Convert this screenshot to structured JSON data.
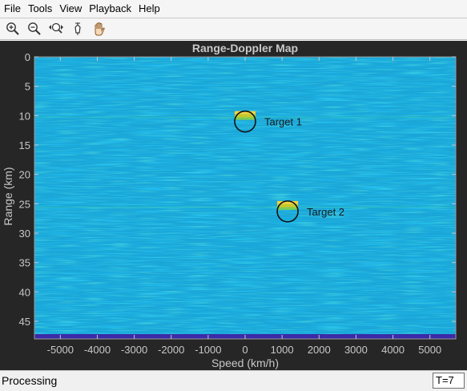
{
  "menu": [
    "File",
    "Tools",
    "View",
    "Playback",
    "Help"
  ],
  "toolbar": {
    "tools": [
      {
        "icon": "zoom-in-icon"
      },
      {
        "icon": "zoom-out-icon"
      },
      {
        "icon": "zoom-fit-icon"
      },
      {
        "icon": "data-cursor-icon"
      },
      {
        "icon": "pan-hand-icon"
      }
    ]
  },
  "chart_data": {
    "type": "heatmap",
    "title": "Range-Doppler Map",
    "xlabel": "Speed (km/h)",
    "ylabel": "Range (km)",
    "xlim": [
      -5700,
      5700
    ],
    "ylim": [
      0,
      48
    ],
    "y_reversed": true,
    "xticks": [
      -5000,
      -4000,
      -3000,
      -2000,
      -1000,
      0,
      1000,
      2000,
      3000,
      4000,
      5000
    ],
    "yticks": [
      0,
      5,
      10,
      15,
      20,
      25,
      30,
      35,
      40,
      45
    ],
    "colormap": "parula",
    "background_level_color": "#1aa6d8",
    "annotations": [
      {
        "label": "Target 1",
        "speed": 0,
        "range": 11
      },
      {
        "label": "Target 2",
        "speed": 1150,
        "range": 26.3
      }
    ]
  },
  "status": {
    "text": "Processing",
    "time": "T=7"
  }
}
